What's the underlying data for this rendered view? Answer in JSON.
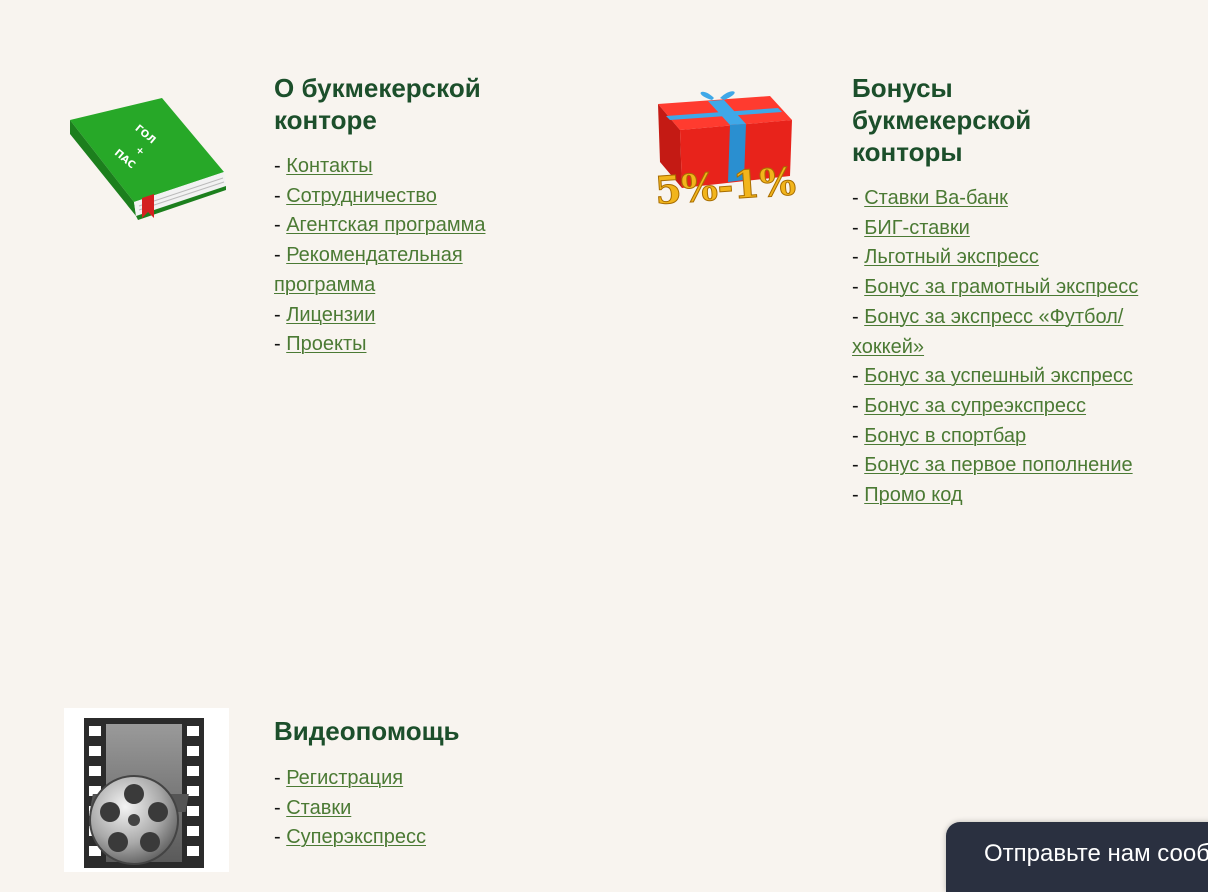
{
  "sections": [
    {
      "title": "О букмекерской конторе",
      "icon": "green-book-icon",
      "book_text": [
        "ГОЛ",
        "+",
        "ПАС"
      ],
      "links": [
        "Контакты",
        "Сотрудничество",
        "Агентская программа",
        "Рекомендательная программа",
        "Лицензии",
        "Проекты"
      ]
    },
    {
      "title": "Бонусы букмекерской конторы",
      "icon": "gift-box-icon",
      "gift_text": "5%-1%",
      "links": [
        "Ставки Ва-банк",
        "БИГ-ставки",
        "Льготный экспресс",
        "Бонус за грамотный экспресс",
        "Бонус за экспресс «Футбол/хоккей»",
        "Бонус за успешный экспресс",
        "Бонус за супреэкспресс",
        "Бонус в спортбар",
        "Бонус за первое пополнение",
        "Промо код"
      ]
    },
    {
      "title": "Видеопомощь",
      "icon": "film-reel-icon",
      "links": [
        "Регистрация",
        "Ставки",
        "Суперэкспресс"
      ]
    }
  ],
  "chat_widget": {
    "icon": "envelope-icon",
    "text": "Отправьте нам сообщение"
  },
  "colors": {
    "background": "#f8f4ef",
    "title": "#1c4f2b",
    "link": "#4b7a34",
    "widget": "#2a3040"
  }
}
